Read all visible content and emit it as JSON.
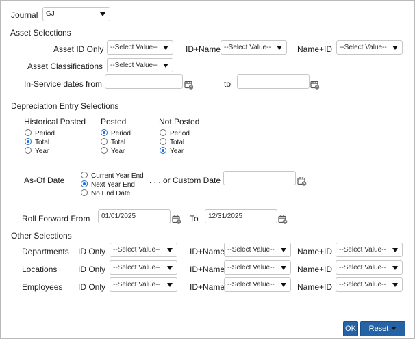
{
  "journal": {
    "label": "Journal",
    "value": "GJ"
  },
  "asset_selections": {
    "heading": "Asset Selections",
    "asset_id_only_label": "Asset ID Only",
    "asset_id_only_value": "--Select Value--",
    "id_name_label": "ID+Name",
    "id_name_value": "--Select Value--",
    "name_id_label": "Name+ID",
    "name_id_value": "--Select Value--",
    "classifications_label": "Asset Classifications",
    "classifications_value": "--Select Value--",
    "in_service_from_label": "In-Service dates from",
    "in_service_from_value": "",
    "to_label": "to",
    "in_service_to_value": ""
  },
  "depreciation": {
    "heading": "Depreciation Entry Selections",
    "groups": [
      {
        "title": "Historical Posted",
        "options": [
          "Period",
          "Total",
          "Year"
        ],
        "selected": "Total"
      },
      {
        "title": "Posted",
        "options": [
          "Period",
          "Total",
          "Year"
        ],
        "selected": "Period"
      },
      {
        "title": "Not Posted",
        "options": [
          "Period",
          "Total",
          "Year"
        ],
        "selected": "Year"
      }
    ]
  },
  "as_of": {
    "label": "As-Of Date",
    "options": [
      "Current Year End",
      "Next Year End",
      "No End Date"
    ],
    "selected": "Next Year End",
    "custom_label": ". . . or Custom Date",
    "custom_value": ""
  },
  "roll_forward": {
    "from_label": "Roll Forward From",
    "from_value": "01/01/2025",
    "to_label": "To",
    "to_value": "12/31/2025"
  },
  "other": {
    "heading": "Other Selections",
    "rows": [
      {
        "label": "Departments",
        "id_only_label": "ID Only",
        "id_only_value": "--Select Value--",
        "id_name_label": "ID+Name",
        "id_name_value": "--Select Value--",
        "name_id_label": "Name+ID",
        "name_id_value": "--Select Value--"
      },
      {
        "label": "Locations",
        "id_only_label": "ID Only",
        "id_only_value": "--Select Value--",
        "id_name_label": "ID+Name",
        "id_name_value": "--Select Value--",
        "name_id_label": "Name+ID",
        "name_id_value": "--Select Value--"
      },
      {
        "label": "Employees",
        "id_only_label": "ID Only",
        "id_only_value": "--Select Value--",
        "id_name_label": "ID+Name",
        "id_name_value": "--Select Value--",
        "name_id_label": "Name+ID",
        "name_id_value": "--Select Value--"
      }
    ]
  },
  "buttons": {
    "ok": "OK",
    "reset": "Reset"
  },
  "icons": {
    "calendar": "calendar-icon",
    "dropdown": "chevron-down-icon"
  },
  "colors": {
    "primary_button": "#2563a6",
    "radio_selected": "#1f6fd9"
  }
}
